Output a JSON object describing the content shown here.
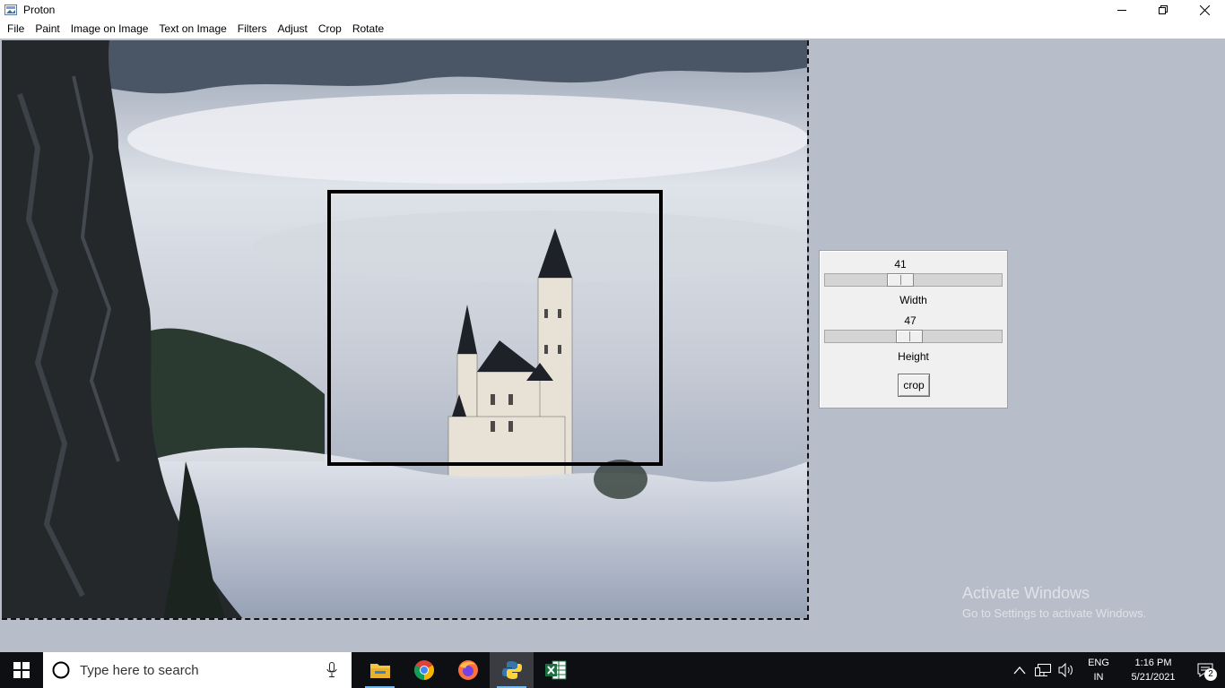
{
  "window": {
    "title": "Proton",
    "icons": {
      "app": "proton-app-icon",
      "minimize": "minimize-icon",
      "maximize": "restore-icon",
      "close": "close-icon"
    }
  },
  "menu": [
    "File",
    "Paint",
    "Image on Image",
    "Text on Image",
    "Filters",
    "Adjust",
    "Crop",
    "Rotate"
  ],
  "canvas": {
    "image_description": "castle in fog",
    "selection_color": "#000000"
  },
  "crop_panel": {
    "width_value": "41",
    "width_label": "Width",
    "height_value": "47",
    "height_label": "Height",
    "crop_button": "crop"
  },
  "watermark": {
    "line1": "Activate Windows",
    "line2": "Go to Settings to activate Windows."
  },
  "taskbar": {
    "search_placeholder": "Type here to search",
    "apps": [
      "file-explorer-icon",
      "chrome-icon",
      "firefox-icon",
      "python-icon",
      "excel-icon"
    ],
    "lang_line1": "ENG",
    "lang_line2": "IN",
    "time": "1:16 PM",
    "date": "5/21/2021",
    "notifications": "2"
  }
}
